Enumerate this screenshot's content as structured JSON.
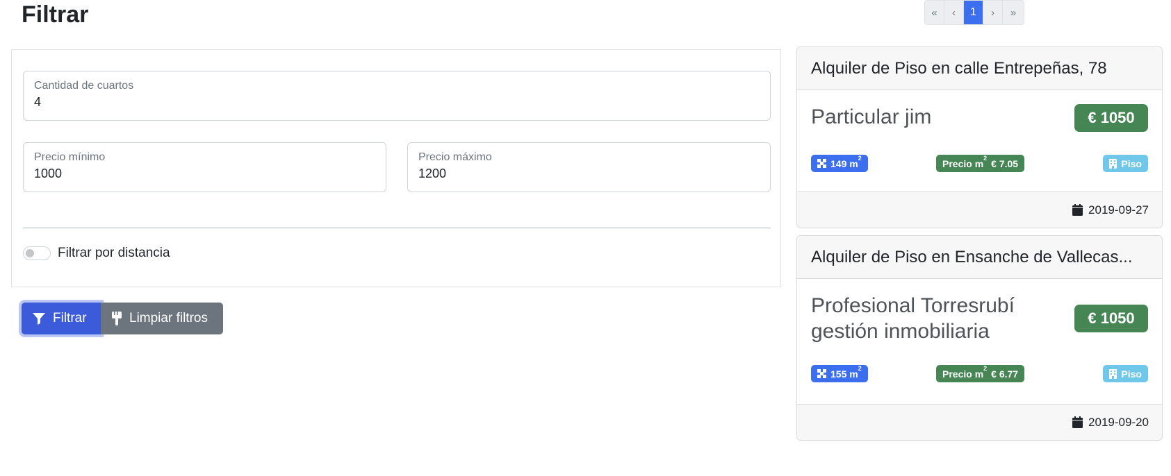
{
  "page": {
    "title": "Filtrar"
  },
  "pagination": {
    "first": "«",
    "prev": "‹",
    "current": "1",
    "next": "›",
    "last": "»"
  },
  "filters": {
    "rooms": {
      "label": "Cantidad de cuartos",
      "value": "4"
    },
    "min_price": {
      "label": "Precio mínimo",
      "value": "1000"
    },
    "max_price": {
      "label": "Precio máximo",
      "value": "1200"
    },
    "distance_toggle": {
      "label": "Filtrar por distancia",
      "checked": false
    }
  },
  "buttons": {
    "filter_label": "Filtrar",
    "clear_label": "Limpiar filtros"
  },
  "listings": [
    {
      "title": "Alquiler de Piso en calle Entrepeñas, 78",
      "agent": "Particular jim",
      "price": "€ 1050",
      "area": "149 m",
      "area_sup": "2",
      "price_m2_label": "Precio m",
      "price_m2_sup": "2",
      "price_m2_value": "€ 7.05",
      "type": "Piso",
      "date": "2019-09-27"
    },
    {
      "title": "Alquiler de Piso en Ensanche de Vallecas...",
      "agent": "Profesional Torresrubí gestión inmobiliaria",
      "price": "€ 1050",
      "area": "155 m",
      "area_sup": "2",
      "price_m2_label": "Precio m",
      "price_m2_sup": "2",
      "price_m2_value": "€ 6.77",
      "type": "Piso",
      "date": "2019-09-20"
    }
  ],
  "colors": {
    "primary": "#3b5bdb",
    "secondary": "#6c757d",
    "success": "#458654",
    "info": "#6fc7ea",
    "pagination_active": "#3c6ef0"
  },
  "icons": {
    "filter_button": "filter-icon",
    "clear_button": "brush-icon",
    "area_badge": "area-icon",
    "type_badge": "building-icon",
    "date": "calendar-icon"
  }
}
